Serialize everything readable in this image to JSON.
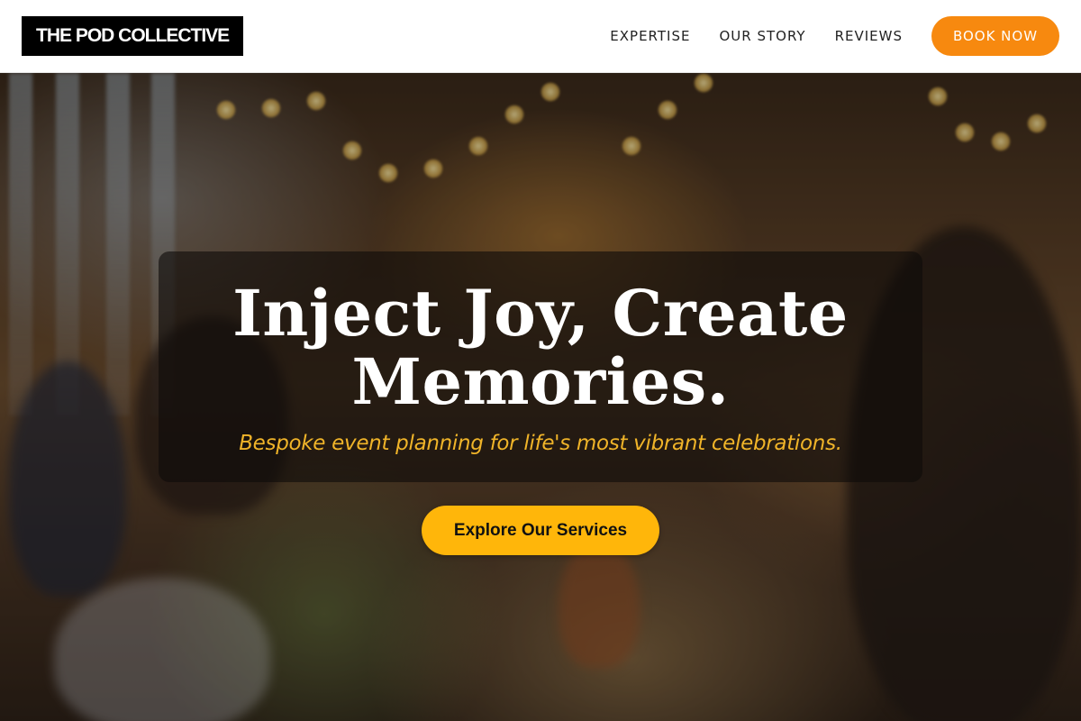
{
  "header": {
    "logo_text": "THE POD COLLECTIVE",
    "nav": [
      {
        "label": "EXPERTISE"
      },
      {
        "label": "OUR STORY"
      },
      {
        "label": "REVIEWS"
      }
    ],
    "book_label": "BOOK NOW"
  },
  "hero": {
    "title_line1": "Inject Joy, Create",
    "title_line2": "Memories.",
    "subtitle": "Bespoke event planning for life's most vibrant celebrations.",
    "cta_label": "Explore Our Services"
  },
  "colors": {
    "accent_orange": "#f7890f",
    "cta_yellow": "#ffb60a",
    "subtitle_gold": "#f0b429",
    "logo_bg": "#000000"
  }
}
